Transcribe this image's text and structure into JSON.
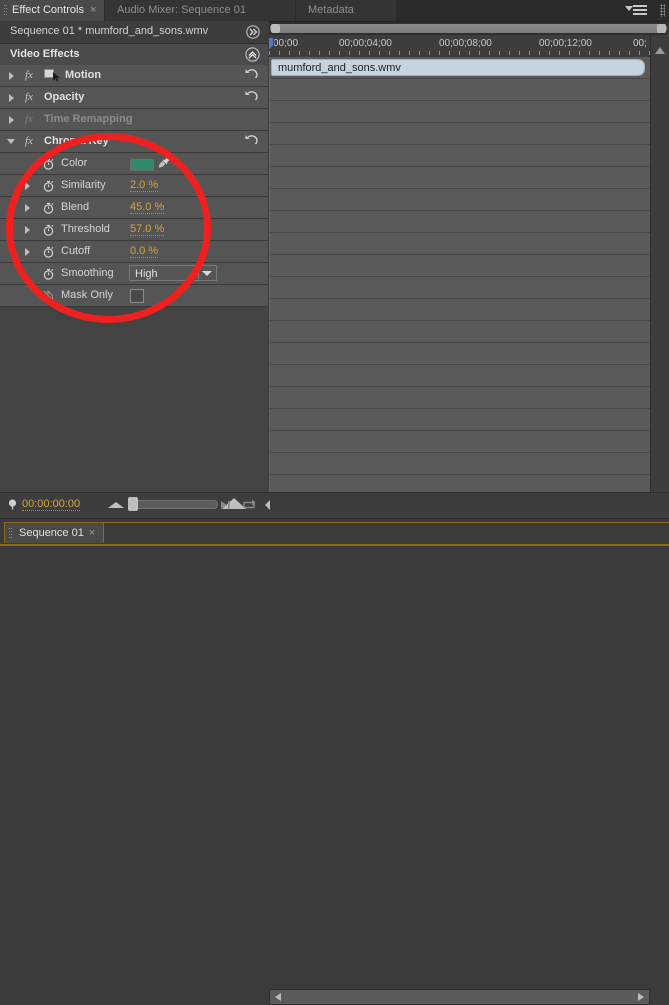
{
  "window": {
    "tabs": [
      {
        "label": "Effect Controls",
        "active": true,
        "closable": true
      },
      {
        "label": "Audio Mixer: Sequence 01",
        "active": false,
        "closable": false
      },
      {
        "label": "Metadata",
        "active": false,
        "closable": false
      }
    ],
    "panel_menu_icon": "hamburger-menu-icon"
  },
  "sequence_header": {
    "title": "Sequence 01 * mumford_and_sons.wmv",
    "collapse_icon": "double-chevron-right-icon"
  },
  "effects_header": {
    "title": "Video Effects",
    "collapse_icon": "double-chevron-up-icon"
  },
  "effects": [
    {
      "name": "Motion",
      "expanded": false,
      "enabled": true,
      "has_reset": true,
      "icon": "transform-icon"
    },
    {
      "name": "Opacity",
      "expanded": false,
      "enabled": true,
      "has_reset": true,
      "icon": ""
    },
    {
      "name": "Time Remapping",
      "expanded": false,
      "enabled": false,
      "has_reset": false,
      "icon": ""
    },
    {
      "name": "Chroma Key",
      "expanded": true,
      "enabled": true,
      "has_reset": true,
      "icon": ""
    }
  ],
  "chroma_key_params": [
    {
      "name": "Color",
      "type": "color",
      "value": "",
      "swatch": "#2f8a6b",
      "expandable": false,
      "eyedropper": true
    },
    {
      "name": "Similarity",
      "type": "percent",
      "value": "2.0 %",
      "expandable": true
    },
    {
      "name": "Blend",
      "type": "percent",
      "value": "45.0 %",
      "expandable": true
    },
    {
      "name": "Threshold",
      "type": "percent",
      "value": "57.0 %",
      "expandable": true
    },
    {
      "name": "Cutoff",
      "type": "percent",
      "value": "0.0 %",
      "expandable": true
    },
    {
      "name": "Smoothing",
      "type": "dropdown",
      "value": "High",
      "expandable": false
    },
    {
      "name": "Mask Only",
      "type": "checkbox",
      "value": "",
      "checked": false,
      "expandable": false
    }
  ],
  "timeline": {
    "ruler_marks": [
      "00;00",
      "00;00;04;00",
      "00;00;08;00",
      "00;00;12;00",
      "00;"
    ],
    "clip_name": "mumford_and_sons.wmv",
    "playhead_icon": "playhead-marker-icon"
  },
  "statusbar": {
    "timecode": "00:00:00:00",
    "keyframe_icon": "keyframe-marker-icon",
    "zoom_out_icon": "small-mountain-icon",
    "zoom_in_icon": "large-mountain-icon",
    "goto_next_icon": "go-to-next-keyframe-icon",
    "loop_icon": "loop-playback-icon",
    "scroll_left_icon": "scroll-left-arrow-icon",
    "scroll_right_icon": "scroll-right-arrow-icon"
  },
  "bottom_tabs": [
    {
      "label": "Sequence 01",
      "active": true,
      "closable": true
    }
  ],
  "colors": {
    "accent_orange": "#d6a43c",
    "annotation_red": "#ee2020",
    "chroma_color_swatch": "#2f8a6b",
    "clip_bar": "#c5d4de"
  },
  "annotation": {
    "shape": "ellipse",
    "color": "#ee2020"
  }
}
